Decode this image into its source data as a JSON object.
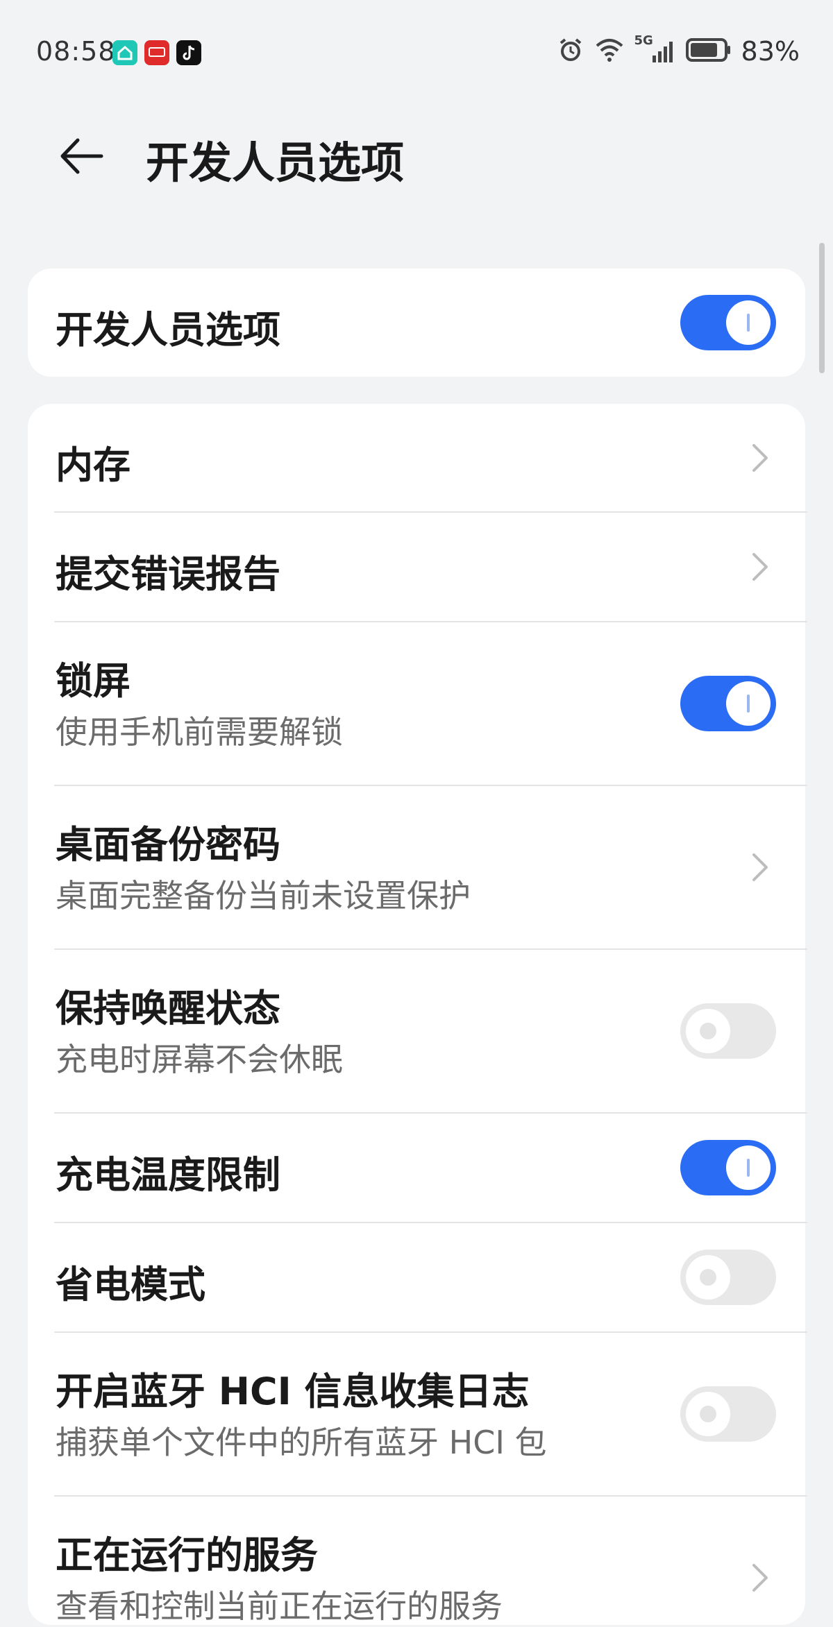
{
  "status_bar": {
    "time": "08:58",
    "battery_percent": "83%",
    "network": "5G",
    "icons": [
      "home-app-icon",
      "cloud-pay-app-icon",
      "tiktok-app-icon",
      "alarm-icon",
      "wifi-icon",
      "signal-icon",
      "battery-icon"
    ],
    "battery_level": 0.83
  },
  "header": {
    "title": "开发人员选项",
    "back_icon": "back-arrow-icon"
  },
  "master_switch": {
    "label": "开发人员选项",
    "enabled": true
  },
  "settings": [
    {
      "id": "memory",
      "title": "内存",
      "control": "chevron"
    },
    {
      "id": "bug-report",
      "title": "提交错误报告",
      "control": "chevron"
    },
    {
      "id": "lock-screen",
      "title": "锁屏",
      "subtitle": "使用手机前需要解锁",
      "control": "toggle",
      "on": true
    },
    {
      "id": "desktop-backup-password",
      "title": "桌面备份密码",
      "subtitle": "桌面完整备份当前未设置保护",
      "control": "chevron"
    },
    {
      "id": "stay-awake",
      "title": "保持唤醒状态",
      "subtitle": "充电时屏幕不会休眠",
      "control": "toggle",
      "on": false
    },
    {
      "id": "charging-temp-limit",
      "title": "充电温度限制",
      "control": "toggle",
      "on": true
    },
    {
      "id": "power-saving-mode",
      "title": "省电模式",
      "control": "toggle",
      "on": false
    },
    {
      "id": "bluetooth-hci-log",
      "title": "开启蓝牙 HCI 信息收集日志",
      "subtitle": "捕获单个文件中的所有蓝牙 HCI 包",
      "control": "toggle",
      "on": false
    },
    {
      "id": "running-services",
      "title": "正在运行的服务",
      "subtitle": "查看和控制当前正在运行的服务",
      "control": "chevron"
    }
  ],
  "colors": {
    "background": "#f1f3f5",
    "card": "#ffffff",
    "toggle_on": "#2a6df4",
    "toggle_off": "#e8e8e8",
    "subtitle": "#6b6b6b"
  }
}
